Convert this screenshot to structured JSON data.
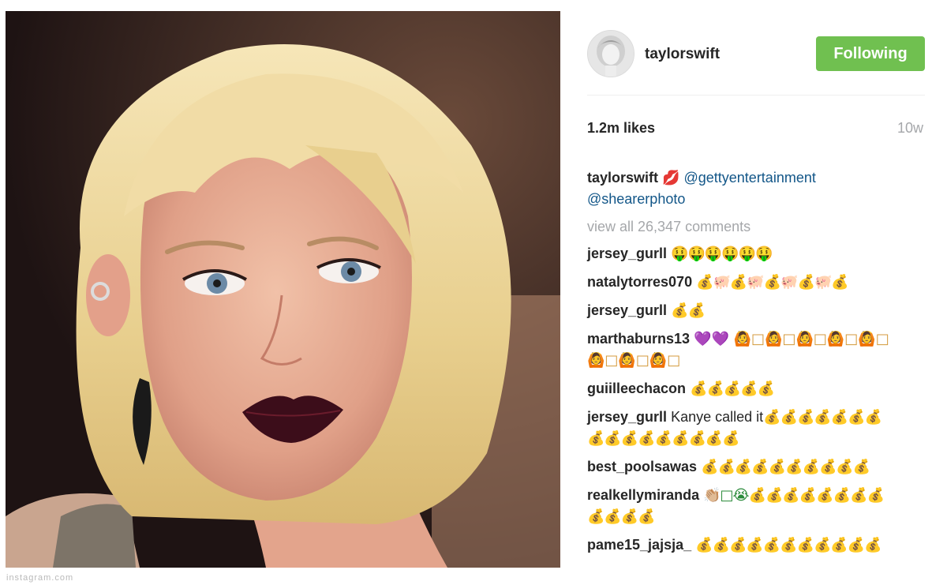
{
  "post": {
    "username": "taylorswift",
    "follow_button": "Following",
    "likes": "1.2m likes",
    "time_ago": "10w",
    "caption": {
      "username": "taylorswift",
      "emoji": "💋",
      "mentions": [
        "@gettyentertainment",
        "@shearerphoto"
      ]
    },
    "view_all_comments": "view all 26,347 comments",
    "comments": [
      {
        "username": "jersey_gurll",
        "lines": [
          "🤑🤑🤑🤑🤑🤑"
        ]
      },
      {
        "username": "natalytorres070",
        "lines": [
          "💰🐖💰🐖💰🐖💰🐖💰"
        ]
      },
      {
        "username": "jersey_gurll",
        "lines": [
          "💰💰"
        ]
      },
      {
        "username": "marthaburns13",
        "lines": [
          "💜💜 🙆□🙆□🙆□🙆□🙆□",
          "🙆□🙆□🙆□"
        ]
      },
      {
        "username": "guiilleechacon",
        "lines": [
          "💰💰💰💰💰"
        ]
      },
      {
        "username": "jersey_gurll",
        "text": "Kanye called it",
        "lines": [
          "💰💰💰💰💰💰💰",
          "💰💰💰💰💰💰💰💰💰"
        ]
      },
      {
        "username": "best_poolsawas",
        "lines": [
          "💰💰💰💰💰💰💰💰💰💰"
        ]
      },
      {
        "username": "realkellymiranda",
        "lines": [
          "👏🏼□😭💰💰💰💰💰💰💰💰",
          "💰💰💰💰"
        ]
      },
      {
        "username": "pame15_jajsja_",
        "lines": [
          "💰💰💰💰💰💰💰💰💰💰💰"
        ]
      }
    ]
  },
  "photo": {
    "below_caption": "instagram.com"
  },
  "colors": {
    "follow_green": "#70c050",
    "mention_blue": "#125688",
    "muted_gray": "#a5a7aa"
  }
}
